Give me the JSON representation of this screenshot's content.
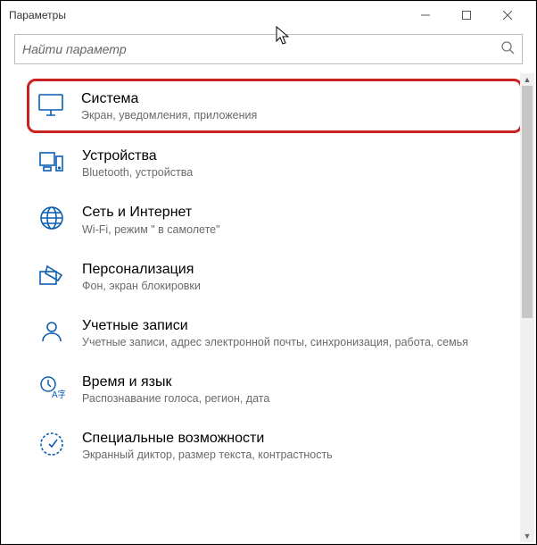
{
  "titlebar": {
    "title": "Параметры"
  },
  "search": {
    "placeholder": "Найти параметр"
  },
  "items": [
    {
      "icon": "monitor",
      "title": "Система",
      "sub": "Экран, уведомления, приложения",
      "highlighted": true
    },
    {
      "icon": "devices",
      "title": "Устройства",
      "sub": "Bluetooth, устройства"
    },
    {
      "icon": "globe",
      "title": "Сеть и Интернет",
      "sub": "Wi-Fi, режим \" в самолете\""
    },
    {
      "icon": "personalize",
      "title": "Персонализация",
      "sub": "Фон, экран блокировки"
    },
    {
      "icon": "account",
      "title": "Учетные записи",
      "sub": "Учетные записи, адрес электронной почты, синхронизация, работа, семья"
    },
    {
      "icon": "time",
      "title": "Время и язык",
      "sub": "Распознавание голоса, регион, дата"
    },
    {
      "icon": "access",
      "title": "Специальные возможности",
      "sub": "Экранный диктор, размер текста, контрастность"
    }
  ]
}
